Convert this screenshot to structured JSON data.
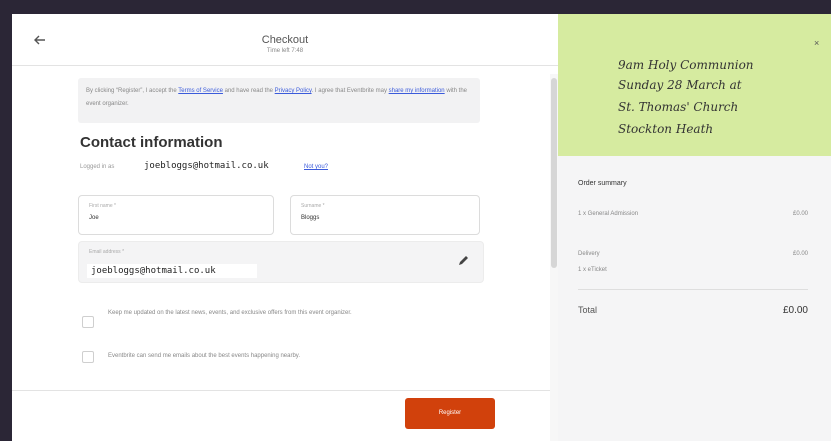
{
  "checkout": {
    "title": "Checkout",
    "subtitle": "Time left 7:48"
  },
  "notice": {
    "part1": "By clicking “Register”, I accept the ",
    "terms_link": "Terms of Service",
    "part2": " and have read the ",
    "privacy_link": "Privacy Policy",
    "part3": ". I agree that Eventbrite may ",
    "share_link": "share my information",
    "part4": " with the event organizer."
  },
  "contact": {
    "title": "Contact information",
    "logged_in_label": "Logged in as",
    "logged_in_email": "joebloggs@hotmail.co.uk",
    "not_you": "Not you?",
    "first_name_label": "First name *",
    "first_name_value": "Joe",
    "surname_label": "Surname *",
    "surname_value": "Bloggs",
    "email_label": "Email address *",
    "email_value": "joebloggs@hotmail.co.uk"
  },
  "options": {
    "keep_updated": "Keep me updated on the latest news, events, and exclusive offers from this event organizer.",
    "eventbrite_emails": "Eventbrite can send me emails about the best events happening nearby."
  },
  "register_label": "Register",
  "event_note": {
    "line1": "9am Holy Communion",
    "line2": "Sunday 28 March at",
    "line3": "St. Thomas' Church",
    "line4": "Stockton Heath",
    "close": "×"
  },
  "summary": {
    "title": "Order summary",
    "items": [
      {
        "label": "1 x General Admission",
        "value": "£0.00"
      },
      {
        "label": "Delivery",
        "value": "£0.00",
        "sub": "1 x eTicket"
      }
    ],
    "total_label": "Total",
    "total_value": "£0.00"
  },
  "colors": {
    "accent": "#d1410c",
    "link": "#3b5bdb",
    "note_bg": "#d6eba0"
  }
}
